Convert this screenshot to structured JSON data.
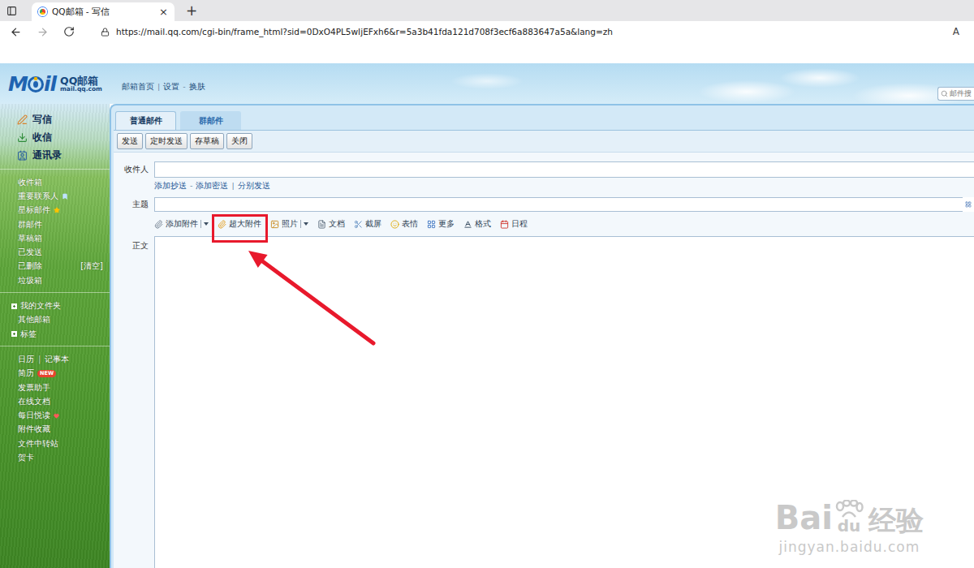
{
  "browser": {
    "tab_title": "QQ邮箱 - 写信",
    "tab_close": "×",
    "new_tab": "+",
    "url": "https://mail.qq.com/cgi-bin/frame_html?sid=0DxO4PL5wIjEFxh6&r=5a3b41fda121d708f3ecf6a883647a5a&lang=zh",
    "reader": "A"
  },
  "header": {
    "logo_left": "M",
    "logo_right": "il",
    "brand": "QQ邮箱",
    "domain": "mail.qq.com",
    "links": [
      {
        "label": "邮箱首页",
        "sep_after": "|"
      },
      {
        "label": "设置",
        "sep_after": "-"
      },
      {
        "label": "换肤",
        "sep_after": ""
      }
    ],
    "search_placeholder": "邮件搜"
  },
  "sidebar": {
    "primary": [
      {
        "label": "写信",
        "kind": "write"
      },
      {
        "label": "收信",
        "kind": "receive"
      },
      {
        "label": "通讯录",
        "kind": "contacts"
      }
    ],
    "folders": [
      {
        "label": "收件箱",
        "kind": "plain",
        "action": ""
      },
      {
        "label": "重要联系人",
        "kind": "vip",
        "action": ""
      },
      {
        "label": "星标邮件",
        "kind": "star",
        "action": ""
      },
      {
        "label": "群邮件",
        "kind": "plain",
        "action": ""
      },
      {
        "label": "草稿箱",
        "kind": "plain",
        "action": ""
      },
      {
        "label": "已发送",
        "kind": "plain",
        "action": ""
      },
      {
        "label": "已删除",
        "kind": "action",
        "action": "[清空]"
      },
      {
        "label": "垃圾箱",
        "kind": "plain",
        "action": ""
      }
    ],
    "groups": [
      {
        "label": "我的文件夹",
        "kind": "group",
        "expanded": false
      },
      {
        "label": "其他邮箱",
        "kind": "item",
        "expanded": false
      },
      {
        "label": "标签",
        "kind": "group",
        "expanded": false
      }
    ],
    "apps": [
      {
        "label": "日历",
        "kind": "pair",
        "sep": "|",
        "extra": "记事本"
      },
      {
        "label": "简历",
        "kind": "new",
        "sep": "",
        "extra": "NEW"
      },
      {
        "label": "发票助手",
        "kind": "plain",
        "sep": "",
        "extra": ""
      },
      {
        "label": "在线文档",
        "kind": "plain",
        "sep": "",
        "extra": ""
      },
      {
        "label": "每日悦读",
        "kind": "hot",
        "sep": "",
        "extra": ""
      },
      {
        "label": "附件收藏",
        "kind": "plain",
        "sep": "",
        "extra": ""
      },
      {
        "label": "文件中转站",
        "kind": "plain",
        "sep": "",
        "extra": ""
      },
      {
        "label": "贺卡",
        "kind": "plain",
        "sep": "",
        "extra": ""
      }
    ]
  },
  "compose": {
    "tabs": [
      {
        "label": "普通邮件",
        "selected": true
      },
      {
        "label": "群邮件",
        "selected": false
      }
    ],
    "actions": [
      "发送",
      "定时发送",
      "存草稿",
      "关闭"
    ],
    "recipient_label": "收件人",
    "recipient_value": "",
    "recipient_links": [
      {
        "label": "添加抄送",
        "sep_after": "-"
      },
      {
        "label": "添加密送",
        "sep_after": "|"
      },
      {
        "label": "分别发送",
        "sep_after": ""
      }
    ],
    "subject_label": "主题",
    "subject_value": "",
    "tools": [
      {
        "label": "添加附件",
        "kind": "attach",
        "has_menu": true,
        "highlighted": false
      },
      {
        "label": "超大附件",
        "kind": "bigattach",
        "has_menu": false,
        "highlighted": true
      },
      {
        "label": "照片",
        "kind": "photo",
        "has_menu": true,
        "highlighted": false
      },
      {
        "label": "文档",
        "kind": "doc",
        "has_menu": false,
        "highlighted": false
      },
      {
        "label": "截屏",
        "kind": "screenshot",
        "has_menu": false,
        "highlighted": false
      },
      {
        "label": "表情",
        "kind": "emoji",
        "has_menu": false,
        "highlighted": false
      },
      {
        "label": "更多",
        "kind": "more",
        "has_menu": false,
        "highlighted": false
      },
      {
        "label": "格式",
        "kind": "format",
        "has_menu": false,
        "highlighted": false
      },
      {
        "label": "日程",
        "kind": "schedule",
        "has_menu": false,
        "highlighted": false
      }
    ],
    "body_label": "正文",
    "body_value": ""
  },
  "watermark": {
    "left": "Bai",
    "paw": "du",
    "right": "经验",
    "url": "jingyan.baidu.com"
  }
}
